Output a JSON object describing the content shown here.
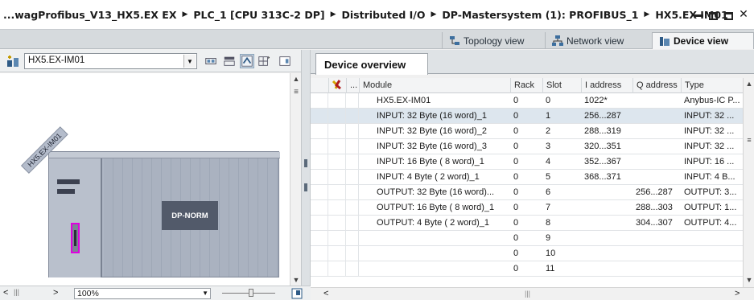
{
  "titlebar": {
    "crumbs": [
      "...wagProfibus_V13_HX5.EX EX",
      "PLC_1 [CPU 313C-2 DP]",
      "Distributed I/O",
      "DP-Mastersystem (1): PROFIBUS_1",
      "HX5.EX-IM01"
    ],
    "separator": "▶",
    "minimize": "",
    "restore": "",
    "maximize": "",
    "close": "✕"
  },
  "view_tabs": {
    "topology": "Topology view",
    "network": "Network view",
    "device": "Device view"
  },
  "left_toolbar": {
    "device_selector": "HX5.EX-IM01",
    "dropdown_arrow": "▼"
  },
  "canvas": {
    "device_label": "HX5.EX-IM01",
    "module_label": "DP-NORM"
  },
  "left_bottom": {
    "zoom": "100%",
    "left_arrow": "<",
    "right_arrow": ">",
    "scroll_marker": "|||",
    "zoom_dropdown": "▼"
  },
  "device_overview": {
    "tab_label": "Device overview",
    "headers": {
      "dots": "...",
      "module": "Module",
      "rack": "Rack",
      "slot": "Slot",
      "iaddr": "I address",
      "qaddr": "Q address",
      "type": "Type"
    },
    "rows": [
      {
        "module": "HX5.EX-IM01",
        "rack": "0",
        "slot": "0",
        "iaddr": "1022*",
        "qaddr": "",
        "type": "Anybus-IC P..."
      },
      {
        "module": "INPUT: 32 Byte (16 word)_1",
        "rack": "0",
        "slot": "1",
        "iaddr": "256...287",
        "qaddr": "",
        "type": "INPUT: 32 ..."
      },
      {
        "module": "INPUT: 32 Byte (16 word)_2",
        "rack": "0",
        "slot": "2",
        "iaddr": "288...319",
        "qaddr": "",
        "type": "INPUT: 32 ..."
      },
      {
        "module": "INPUT: 32 Byte (16 word)_3",
        "rack": "0",
        "slot": "3",
        "iaddr": "320...351",
        "qaddr": "",
        "type": "INPUT: 32 ..."
      },
      {
        "module": "INPUT: 16 Byte ( 8 word)_1",
        "rack": "0",
        "slot": "4",
        "iaddr": "352...367",
        "qaddr": "",
        "type": "INPUT: 16 ..."
      },
      {
        "module": "INPUT: 4 Byte ( 2 word)_1",
        "rack": "0",
        "slot": "5",
        "iaddr": "368...371",
        "qaddr": "",
        "type": "INPUT: 4 B..."
      },
      {
        "module": "OUTPUT: 32 Byte (16 word)...",
        "rack": "0",
        "slot": "6",
        "iaddr": "",
        "qaddr": "256...287",
        "type": "OUTPUT: 3..."
      },
      {
        "module": "OUTPUT: 16 Byte ( 8 word)_1",
        "rack": "0",
        "slot": "7",
        "iaddr": "",
        "qaddr": "288...303",
        "type": "OUTPUT: 1..."
      },
      {
        "module": "OUTPUT: 4 Byte ( 2 word)_1",
        "rack": "0",
        "slot": "8",
        "iaddr": "",
        "qaddr": "304...307",
        "type": "OUTPUT: 4..."
      },
      {
        "module": "",
        "rack": "0",
        "slot": "9",
        "iaddr": "",
        "qaddr": "",
        "type": ""
      },
      {
        "module": "",
        "rack": "0",
        "slot": "10",
        "iaddr": "",
        "qaddr": "",
        "type": ""
      },
      {
        "module": "",
        "rack": "0",
        "slot": "11",
        "iaddr": "",
        "qaddr": "",
        "type": ""
      }
    ],
    "selected_row": 1
  },
  "scroll": {
    "up": "▲",
    "down": "▼",
    "left": "<",
    "right": ">",
    "hmark": "|||",
    "vmark": "≡"
  },
  "icons": {
    "device_toolbar": "network-device-icon",
    "topology": "topology-icon",
    "network": "network-icon",
    "device": "device-icon",
    "colors": {
      "accent": "#e000e0",
      "rack": "#aeb6c4",
      "module": "#525a6a",
      "selection": "#dde6ee"
    }
  }
}
